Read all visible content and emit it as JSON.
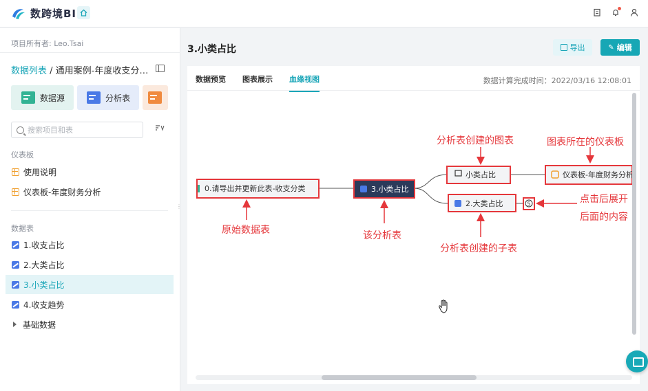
{
  "app": {
    "title": "数跨境BI"
  },
  "sidebar": {
    "owner_label": "项目所有者: Leo.Tsai",
    "breadcrumb_link": "数据列表",
    "breadcrumb_sep": " / ",
    "breadcrumb_current": "通用案例-年度收支分…",
    "quick_actions": [
      {
        "label": "数据源"
      },
      {
        "label": "分析表"
      }
    ],
    "search_placeholder": "搜索项目和表",
    "sections": {
      "dashboard": "仪表板",
      "datatable": "数据表"
    },
    "dashboards": [
      {
        "label": "使用说明"
      },
      {
        "label": "仪表板-年度财务分析"
      }
    ],
    "tables": [
      {
        "label": "1.收支占比"
      },
      {
        "label": "2.大类占比"
      },
      {
        "label": "3.小类占比"
      },
      {
        "label": "4.收支趋势"
      },
      {
        "label": "基础数据"
      }
    ]
  },
  "main": {
    "title": "3.小类占比",
    "export_label": "导出",
    "edit_label": "编辑",
    "tabs": [
      {
        "label": "数据预览"
      },
      {
        "label": "图表展示"
      },
      {
        "label": "血缘视图"
      }
    ],
    "active_tab": "血缘视图",
    "calc_time": "数据计算完成时间：2022/03/16 12:08:01"
  },
  "lineage": {
    "nodes": {
      "source": "0.请导出并更新此表-收支分类",
      "current": "3.小类占比",
      "chart": "小类占比",
      "dashboard": "仪表板-年度财务分析",
      "child": "2.大类占比"
    },
    "expand_count": "5",
    "annotations": {
      "source": "原始数据表",
      "current": "该分析表",
      "chart": "分析表创建的图表",
      "dashboard": "图表所在的仪表板",
      "child": "分析表创建的子表",
      "expand_line1": "点击后展开",
      "expand_line2": "后面的内容"
    }
  },
  "colors": {
    "accent": "#1ba6b8",
    "annotation": "#e5373b",
    "current_node": "#2b3a5a"
  }
}
